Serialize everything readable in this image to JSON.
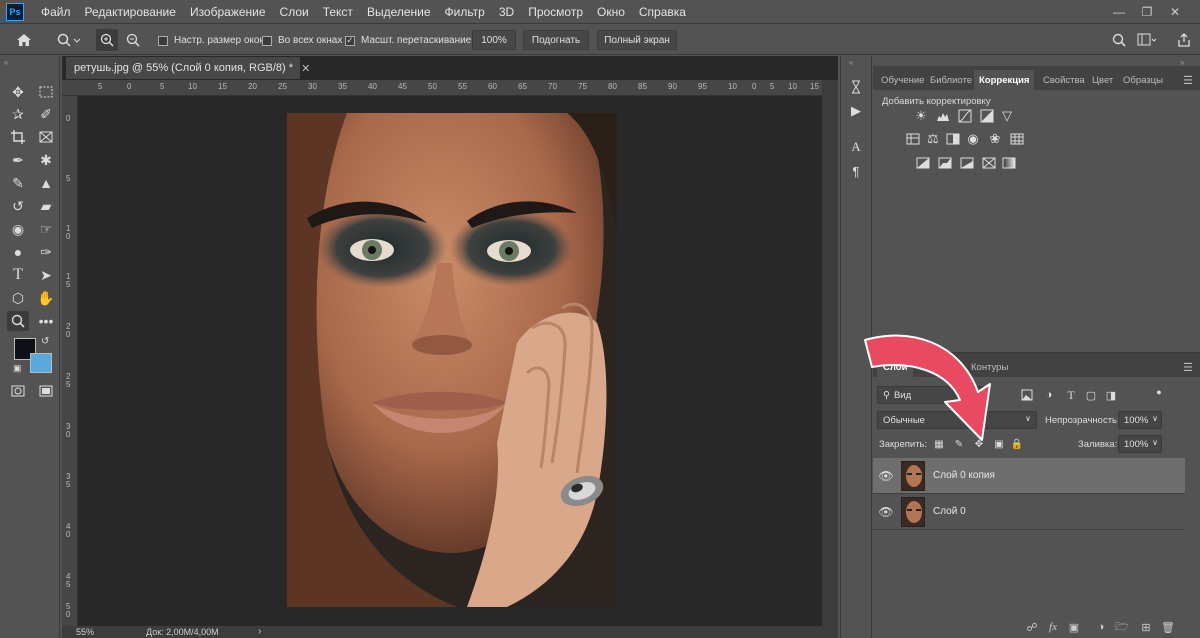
{
  "menubar": {
    "logo": "Ps",
    "items": [
      "Файл",
      "Редактирование",
      "Изображение",
      "Слои",
      "Текст",
      "Выделение",
      "Фильтр",
      "3D",
      "Просмотр",
      "Окно",
      "Справка"
    ],
    "icons": [
      "minimize-icon",
      "restore-icon",
      "close-icon"
    ]
  },
  "options": {
    "resize_windows": "Настр. размер окон",
    "all_windows": "Во всех окнах",
    "scrubby_zoom": "Масшт. перетаскиванием",
    "zoom_value": "100%",
    "fit_button": "Подогнать",
    "fullscreen_button": "Полный экран",
    "checked": {
      "resize_windows": false,
      "all_windows": false,
      "scrubby_zoom": true
    }
  },
  "document": {
    "tab_title": "ретушь.jpg @ 55% (Слой 0 копия, RGB/8) *",
    "ruler_top": [
      "5",
      "0",
      "5",
      "10",
      "15",
      "20",
      "25",
      "30",
      "35",
      "40",
      "45",
      "50",
      "55",
      "60",
      "65",
      "70",
      "75",
      "80",
      "85",
      "90",
      "95",
      "10",
      "0",
      "5",
      "10",
      "15"
    ],
    "ruler_left": [
      "0",
      "5",
      "1",
      "0",
      "1",
      "5",
      "2",
      "0",
      "2",
      "5",
      "3",
      "0",
      "3",
      "5",
      "4",
      "0",
      "4",
      "5",
      "5",
      "0"
    ],
    "zoom": "55%",
    "doc_size": "Док: 2,00M/4,00M"
  },
  "correction_panel": {
    "tabs": [
      "Обучение",
      "Библиоте",
      "Коррекция",
      "Свойства",
      "Цвет",
      "Образцы"
    ],
    "active_tab": "Коррекция",
    "add_label": "Добавить корректировку"
  },
  "layers_panel": {
    "tabs": [
      "Слои",
      "Каналы",
      "Контуры"
    ],
    "active_tab": "Слои",
    "filter_kind": "Вид",
    "blend_mode": "Обычные",
    "opacity_label": "Непрозрачность:",
    "opacity_value": "100%",
    "lock_label": "Закрепить:",
    "fill_label": "Заливка:",
    "fill_value": "100%",
    "layers": [
      {
        "name": "Слой 0 копия",
        "visible": true,
        "selected": true
      },
      {
        "name": "Слой 0",
        "visible": true,
        "selected": false
      }
    ],
    "bottom_icons": [
      "link-icon",
      "fx-icon",
      "mask-icon",
      "adjustment-icon",
      "folder-icon",
      "new-layer-icon",
      "trash-icon"
    ]
  },
  "colors": {
    "foreground": "#0d1117",
    "background": "#5aa9de",
    "arrow": "#e84a62"
  }
}
